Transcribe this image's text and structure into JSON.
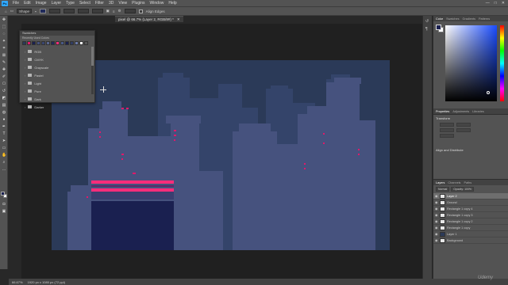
{
  "app": {
    "logo": "Ps"
  },
  "menu": [
    "File",
    "Edit",
    "Image",
    "Layer",
    "Type",
    "Select",
    "Filter",
    "3D",
    "View",
    "Plugins",
    "Window",
    "Help"
  ],
  "window_controls": [
    "—",
    "□",
    "✕"
  ],
  "options": {
    "tool_mode": "Shape",
    "align_edges": "Align Edges"
  },
  "document": {
    "tab_title": "pixel @ 66.7% (Layer 2, RGB/8#) *"
  },
  "swatches_panel": {
    "title": "Swatches",
    "recent_label": "Recently Used Colors",
    "recent_colors": [
      "#2b3a58",
      "#e0196b",
      "#1a2050",
      "#46527e",
      "#3a4670",
      "#5a6690",
      "#202a5a",
      "#ff2d7a",
      "#4a5a86",
      "#1a2050",
      "#303c62",
      "#6b79a8",
      "#ffffff",
      "#555555"
    ],
    "folders": [
      "RGB",
      "CMYK",
      "Grayscale",
      "Pastel",
      "Light",
      "Pure",
      "Dark",
      "Darker"
    ]
  },
  "right_panels": {
    "color_tabs": [
      "Color",
      "Swatches",
      "Gradients",
      "Patterns"
    ],
    "properties_tabs": [
      "Properties",
      "Adjustments",
      "Libraries"
    ],
    "transform_label": "Transform",
    "align_label": "Align and Distribute",
    "layers_tabs": [
      "Layers",
      "Channels",
      "Paths"
    ],
    "blend_mode": "Normal",
    "opacity_label": "Opacity: 100%",
    "layers": [
      {
        "name": "Layer 2",
        "selected": true,
        "dark": false
      },
      {
        "name": "Ground",
        "selected": false,
        "dark": false
      },
      {
        "name": "Rectangle 1 copy 4",
        "selected": false,
        "dark": false
      },
      {
        "name": "Rectangle 1 copy 3",
        "selected": false,
        "dark": false
      },
      {
        "name": "Rectangle 1 copy 2",
        "selected": false,
        "dark": false
      },
      {
        "name": "Rectangle 1 copy",
        "selected": false,
        "dark": false
      },
      {
        "name": "Layer 1",
        "selected": false,
        "dark": true
      },
      {
        "name": "Background",
        "selected": false,
        "dark": false
      }
    ]
  },
  "status": {
    "zoom": "66.67%",
    "size": "1920 px x 1080 px (72 ppi)"
  },
  "watermark": "Udemy",
  "colors": {
    "sky": "#2b3a58",
    "building_back": "#34446a",
    "building_front": "#46527e",
    "neon": "#e0196b",
    "door": "#1a2050"
  }
}
